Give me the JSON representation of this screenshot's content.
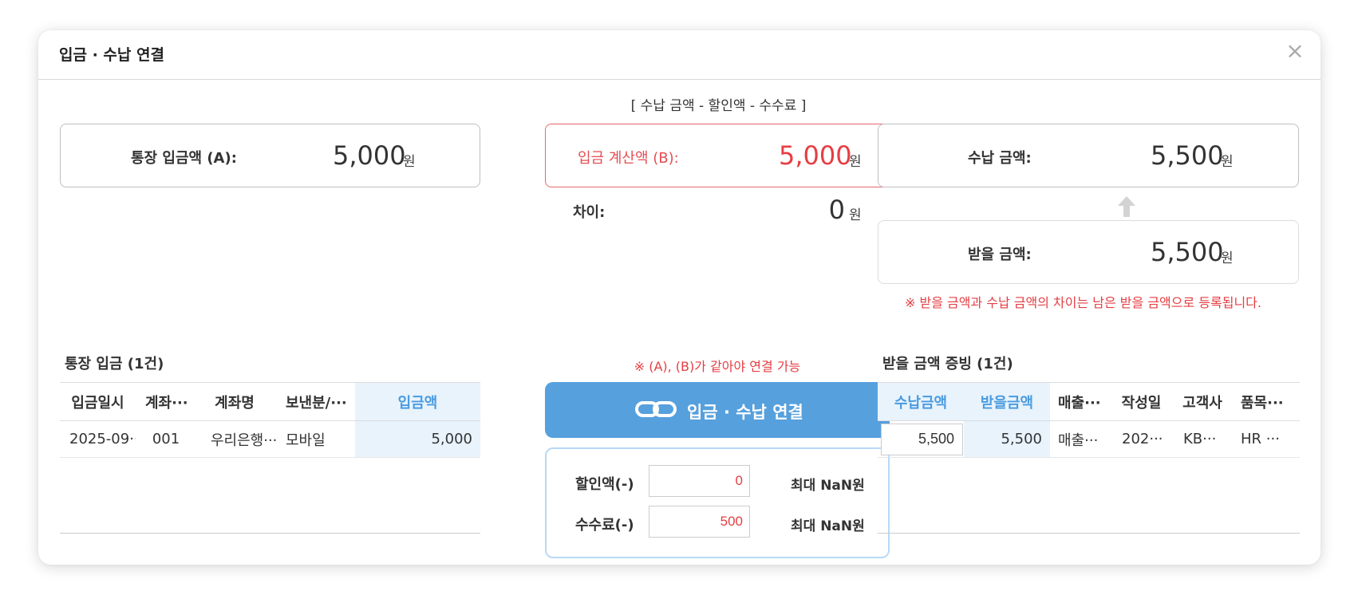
{
  "dialog": {
    "title": "입금 · 수납 연결",
    "close_glyph": "×"
  },
  "formula_note": "[ 수납 금액 - 할인액 - 수수료 ]",
  "bank_deposit": {
    "label": "통장 입금액 (A):",
    "value": "5,000",
    "unit": "원"
  },
  "calc_deposit": {
    "label": "입금 계산액 (B):",
    "value": "5,000",
    "unit": "원"
  },
  "difference": {
    "label": "차이:",
    "value": "0",
    "unit": "원"
  },
  "received_amount": {
    "label": "수납 금액:",
    "value": "5,500",
    "unit": "원"
  },
  "receivable_amount": {
    "label": "받을 금액:",
    "value": "5,500",
    "unit": "원"
  },
  "receivable_notice": "※ 받을 금액과 수납 금액의 차이는 남은 받을 금액으로 등록됩니다.",
  "link_condition_notice": "※ (A), (B)가 같아야 연결 가능",
  "link_button_label": "입금 · 수납 연결",
  "bank_table": {
    "title": "통장 입금 (1건)",
    "columns": [
      "입금일시",
      "계좌···",
      "계좌명",
      "보낸분/···",
      "입금액"
    ],
    "rows": [
      [
        "2025-09···",
        "001",
        "우리은행···",
        "모바일",
        "5,000"
      ]
    ]
  },
  "receivable_table": {
    "title": "받을 금액 증빙 (1건)",
    "columns": [
      "수납금액",
      "받을금액",
      "매출···",
      "작성일",
      "고객사",
      "품목···"
    ],
    "rows": [
      [
        "5,500",
        "5,500",
        "매출···",
        "202···",
        "KB···",
        "HR ···"
      ]
    ]
  },
  "adjustments": {
    "discount": {
      "label": "할인액(-)",
      "value": "0",
      "max": "최대 NaN원"
    },
    "fee": {
      "label": "수수료(-)",
      "value": "500",
      "max": "최대 NaN원"
    }
  },
  "colors": {
    "accent_blue": "#56a0dd",
    "red": "#e53e43",
    "highlight_bg": "#e8f3fc"
  }
}
